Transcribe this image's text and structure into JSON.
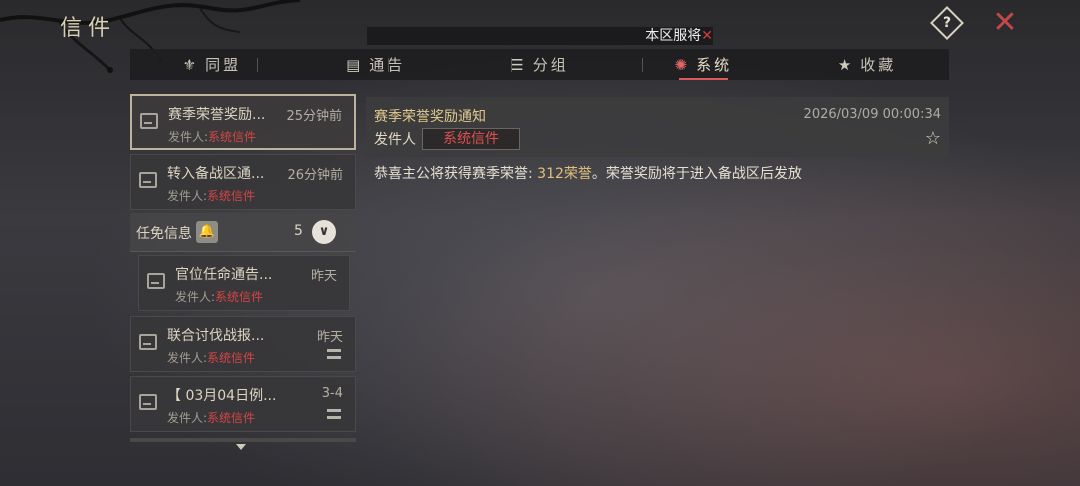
{
  "window": {
    "title": "信件"
  },
  "header": {
    "help_label": "?",
    "close_label": "✕"
  },
  "notice": {
    "text": "本区服将",
    "close_mark": "✕"
  },
  "tabs": [
    {
      "label": "同盟",
      "icon": "alliance-icon"
    },
    {
      "label": "通告",
      "icon": "announcement-icon"
    },
    {
      "label": "分组",
      "icon": "group-icon"
    },
    {
      "label": "系统",
      "icon": "system-icon",
      "active": true
    },
    {
      "label": "收藏",
      "icon": "star-icon"
    }
  ],
  "mail_list": [
    {
      "subject": "赛季荣誉奖励...",
      "time": "25分钟前",
      "from_label": "发件人:",
      "from": "系统信件",
      "selected": true
    },
    {
      "subject": "转入备战区通...",
      "time": "26分钟前",
      "from_label": "发件人:",
      "from": "系统信件"
    }
  ],
  "group": {
    "label": "任免信息",
    "count": "5",
    "bell_icon": "bell-icon",
    "expand_icon": "chevron-down-icon"
  },
  "group_items": [
    {
      "subject": "官位任命通告...",
      "time": "昨天",
      "from_label": "发件人:",
      "from": "系统信件"
    }
  ],
  "mail_list_more": [
    {
      "subject": "联合讨伐战报...",
      "time": "昨天",
      "from_label": "发件人:",
      "from": "系统信件"
    },
    {
      "subject": "【 03月04日例...",
      "time": "3-4",
      "from_label": "发件人:",
      "from": "系统信件"
    }
  ],
  "detail": {
    "title": "赛季荣誉奖励通知",
    "date": "2026/03/09 00:00:34",
    "from_label": "发件人",
    "from": "系统信件",
    "body_prefix": "恭喜主公将获得赛季荣誉: ",
    "body_highlight": "312荣誉",
    "body_suffix": "。荣誉奖励将于进入备战区后发放"
  },
  "colors": {
    "accent_red": "#d64545",
    "title_gold": "#e0c98d",
    "highlight": "#e0c17a"
  }
}
